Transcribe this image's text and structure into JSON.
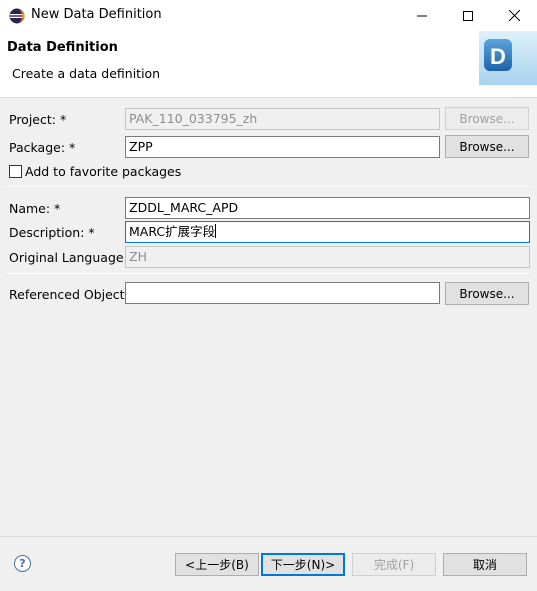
{
  "window": {
    "title": "New Data Definition",
    "min_glyph": "—",
    "max_glyph": "☐",
    "close_glyph": "✕"
  },
  "header": {
    "title": "Data Definition",
    "subtitle": "Create a data definition",
    "logo_letter": "D"
  },
  "form": {
    "project": {
      "label": "Project: *",
      "value": "PAK_110_033795_zh",
      "browse": "Browse..."
    },
    "package": {
      "label": "Package: *",
      "value": "ZPP",
      "browse": "Browse..."
    },
    "favorite": {
      "label": "Add to favorite packages",
      "checked": false
    },
    "name": {
      "label": "Name: *",
      "value": "ZDDL_MARC_APD"
    },
    "description": {
      "label": "Description: *",
      "value": "MARC扩展字段"
    },
    "original_language": {
      "label": "Original Language:",
      "value": "ZH"
    },
    "referenced_object": {
      "label": "Referenced Object:",
      "value": "",
      "browse": "Browse..."
    }
  },
  "footer": {
    "help_glyph": "?",
    "back": "<上一步(B)",
    "next": "下一步(N)>",
    "finish": "完成(F)",
    "cancel": "取消"
  },
  "colors": {
    "accent": "#0078d7",
    "logo_blue": "#2f7ec3"
  }
}
